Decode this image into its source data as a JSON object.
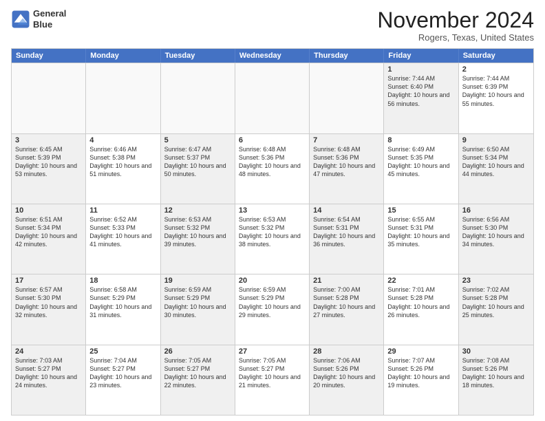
{
  "logo": {
    "line1": "General",
    "line2": "Blue"
  },
  "title": "November 2024",
  "location": "Rogers, Texas, United States",
  "day_headers": [
    "Sunday",
    "Monday",
    "Tuesday",
    "Wednesday",
    "Thursday",
    "Friday",
    "Saturday"
  ],
  "weeks": [
    [
      {
        "day": "",
        "info": "",
        "empty": true
      },
      {
        "day": "",
        "info": "",
        "empty": true
      },
      {
        "day": "",
        "info": "",
        "empty": true
      },
      {
        "day": "",
        "info": "",
        "empty": true
      },
      {
        "day": "",
        "info": "",
        "empty": true
      },
      {
        "day": "1",
        "info": "Sunrise: 7:44 AM\nSunset: 6:40 PM\nDaylight: 10 hours and 56 minutes.",
        "empty": false,
        "shaded": true
      },
      {
        "day": "2",
        "info": "Sunrise: 7:44 AM\nSunset: 6:39 PM\nDaylight: 10 hours and 55 minutes.",
        "empty": false,
        "shaded": false
      }
    ],
    [
      {
        "day": "3",
        "info": "Sunrise: 6:45 AM\nSunset: 5:39 PM\nDaylight: 10 hours and 53 minutes.",
        "empty": false,
        "shaded": true
      },
      {
        "day": "4",
        "info": "Sunrise: 6:46 AM\nSunset: 5:38 PM\nDaylight: 10 hours and 51 minutes.",
        "empty": false,
        "shaded": false
      },
      {
        "day": "5",
        "info": "Sunrise: 6:47 AM\nSunset: 5:37 PM\nDaylight: 10 hours and 50 minutes.",
        "empty": false,
        "shaded": true
      },
      {
        "day": "6",
        "info": "Sunrise: 6:48 AM\nSunset: 5:36 PM\nDaylight: 10 hours and 48 minutes.",
        "empty": false,
        "shaded": false
      },
      {
        "day": "7",
        "info": "Sunrise: 6:48 AM\nSunset: 5:36 PM\nDaylight: 10 hours and 47 minutes.",
        "empty": false,
        "shaded": true
      },
      {
        "day": "8",
        "info": "Sunrise: 6:49 AM\nSunset: 5:35 PM\nDaylight: 10 hours and 45 minutes.",
        "empty": false,
        "shaded": false
      },
      {
        "day": "9",
        "info": "Sunrise: 6:50 AM\nSunset: 5:34 PM\nDaylight: 10 hours and 44 minutes.",
        "empty": false,
        "shaded": true
      }
    ],
    [
      {
        "day": "10",
        "info": "Sunrise: 6:51 AM\nSunset: 5:34 PM\nDaylight: 10 hours and 42 minutes.",
        "empty": false,
        "shaded": true
      },
      {
        "day": "11",
        "info": "Sunrise: 6:52 AM\nSunset: 5:33 PM\nDaylight: 10 hours and 41 minutes.",
        "empty": false,
        "shaded": false
      },
      {
        "day": "12",
        "info": "Sunrise: 6:53 AM\nSunset: 5:32 PM\nDaylight: 10 hours and 39 minutes.",
        "empty": false,
        "shaded": true
      },
      {
        "day": "13",
        "info": "Sunrise: 6:53 AM\nSunset: 5:32 PM\nDaylight: 10 hours and 38 minutes.",
        "empty": false,
        "shaded": false
      },
      {
        "day": "14",
        "info": "Sunrise: 6:54 AM\nSunset: 5:31 PM\nDaylight: 10 hours and 36 minutes.",
        "empty": false,
        "shaded": true
      },
      {
        "day": "15",
        "info": "Sunrise: 6:55 AM\nSunset: 5:31 PM\nDaylight: 10 hours and 35 minutes.",
        "empty": false,
        "shaded": false
      },
      {
        "day": "16",
        "info": "Sunrise: 6:56 AM\nSunset: 5:30 PM\nDaylight: 10 hours and 34 minutes.",
        "empty": false,
        "shaded": true
      }
    ],
    [
      {
        "day": "17",
        "info": "Sunrise: 6:57 AM\nSunset: 5:30 PM\nDaylight: 10 hours and 32 minutes.",
        "empty": false,
        "shaded": true
      },
      {
        "day": "18",
        "info": "Sunrise: 6:58 AM\nSunset: 5:29 PM\nDaylight: 10 hours and 31 minutes.",
        "empty": false,
        "shaded": false
      },
      {
        "day": "19",
        "info": "Sunrise: 6:59 AM\nSunset: 5:29 PM\nDaylight: 10 hours and 30 minutes.",
        "empty": false,
        "shaded": true
      },
      {
        "day": "20",
        "info": "Sunrise: 6:59 AM\nSunset: 5:29 PM\nDaylight: 10 hours and 29 minutes.",
        "empty": false,
        "shaded": false
      },
      {
        "day": "21",
        "info": "Sunrise: 7:00 AM\nSunset: 5:28 PM\nDaylight: 10 hours and 27 minutes.",
        "empty": false,
        "shaded": true
      },
      {
        "day": "22",
        "info": "Sunrise: 7:01 AM\nSunset: 5:28 PM\nDaylight: 10 hours and 26 minutes.",
        "empty": false,
        "shaded": false
      },
      {
        "day": "23",
        "info": "Sunrise: 7:02 AM\nSunset: 5:28 PM\nDaylight: 10 hours and 25 minutes.",
        "empty": false,
        "shaded": true
      }
    ],
    [
      {
        "day": "24",
        "info": "Sunrise: 7:03 AM\nSunset: 5:27 PM\nDaylight: 10 hours and 24 minutes.",
        "empty": false,
        "shaded": true
      },
      {
        "day": "25",
        "info": "Sunrise: 7:04 AM\nSunset: 5:27 PM\nDaylight: 10 hours and 23 minutes.",
        "empty": false,
        "shaded": false
      },
      {
        "day": "26",
        "info": "Sunrise: 7:05 AM\nSunset: 5:27 PM\nDaylight: 10 hours and 22 minutes.",
        "empty": false,
        "shaded": true
      },
      {
        "day": "27",
        "info": "Sunrise: 7:05 AM\nSunset: 5:27 PM\nDaylight: 10 hours and 21 minutes.",
        "empty": false,
        "shaded": false
      },
      {
        "day": "28",
        "info": "Sunrise: 7:06 AM\nSunset: 5:26 PM\nDaylight: 10 hours and 20 minutes.",
        "empty": false,
        "shaded": true
      },
      {
        "day": "29",
        "info": "Sunrise: 7:07 AM\nSunset: 5:26 PM\nDaylight: 10 hours and 19 minutes.",
        "empty": false,
        "shaded": false
      },
      {
        "day": "30",
        "info": "Sunrise: 7:08 AM\nSunset: 5:26 PM\nDaylight: 10 hours and 18 minutes.",
        "empty": false,
        "shaded": true
      }
    ]
  ]
}
